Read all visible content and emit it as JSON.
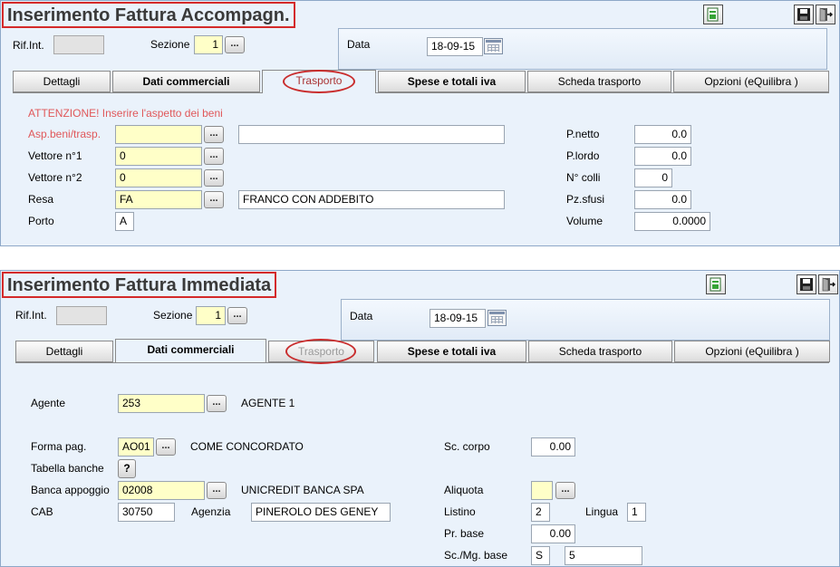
{
  "top": {
    "title": "Inserimento Fattura Accompagn.",
    "rif_int_label": "Rif.Int.",
    "sezione_label": "Sezione",
    "sezione_value": "1",
    "data_label": "Data",
    "data_value": "18-09-15",
    "tabs": [
      {
        "label": "Dettagli"
      },
      {
        "label": "Dati commerciali"
      },
      {
        "label": "Trasporto"
      },
      {
        "label": "Spese e totali iva"
      },
      {
        "label": "Scheda trasporto"
      },
      {
        "label": "Opzioni (eQuilibra )"
      }
    ],
    "warning": "ATTENZIONE! Inserire l'aspetto dei beni",
    "asp_label": "Asp.beni/trasp.",
    "vettore1_label": "Vettore n°1",
    "vettore1_value": "0",
    "vettore2_label": "Vettore n°2",
    "vettore2_value": "0",
    "resa_label": "Resa",
    "resa_value": "FA",
    "resa_desc": "FRANCO CON ADDEBITO",
    "porto_label": "Porto",
    "porto_value": "A",
    "pnetto_label": "P.netto",
    "pnetto_value": "0.0",
    "plordo_label": "P.lordo",
    "plordo_value": "0.0",
    "ncolli_label": "N° colli",
    "ncolli_value": "0",
    "pzsfusi_label": "Pz.sfusi",
    "pzsfusi_value": "0.0",
    "volume_label": "Volume",
    "volume_value": "0.0000"
  },
  "bottom": {
    "title": "Inserimento Fattura Immediata",
    "rif_int_label": "Rif.Int.",
    "sezione_label": "Sezione",
    "sezione_value": "1",
    "data_label": "Data",
    "data_value": "18-09-15",
    "tabs": [
      {
        "label": "Dettagli"
      },
      {
        "label": "Dati commerciali"
      },
      {
        "label": "Trasporto"
      },
      {
        "label": "Spese e totali iva"
      },
      {
        "label": "Scheda trasporto"
      },
      {
        "label": "Opzioni (eQuilibra )"
      }
    ],
    "agente_label": "Agente",
    "agente_value": "253",
    "agente_desc": "AGENTE 1",
    "forma_label": "Forma pag.",
    "forma_value": "AO01",
    "forma_desc": "COME CONCORDATO",
    "tabella_label": "Tabella banche",
    "tabella_btn": "?",
    "banca_label": "Banca appoggio",
    "banca_value": "02008",
    "banca_desc": "UNICREDIT BANCA SPA",
    "cab_label": "CAB",
    "cab_value": "30750",
    "agenzia_label": "Agenzia",
    "agenzia_value": "PINEROLO DES GENEY",
    "sccorpo_label": "Sc. corpo",
    "sccorpo_value": "0.00",
    "aliquota_label": "Aliquota",
    "listino_label": "Listino",
    "listino_value": "2",
    "lingua_label": "Lingua",
    "lingua_value": "1",
    "prbase_label": "Pr. base",
    "prbase_value": "0.00",
    "scmg_label": "Sc./Mg. base",
    "scmg_value1": "S",
    "scmg_value2": "5"
  },
  "buttons": {
    "dots": "...",
    "new_icon": "document-icon",
    "save_icon": "floppy-disk-icon",
    "exit_icon": "exit-door-icon"
  },
  "colors": {
    "panel_bg": "#eaf2fb",
    "highlight_red": "#d42a2a",
    "warning_text": "#e0585a",
    "field_yellow": "#ffffc8"
  }
}
